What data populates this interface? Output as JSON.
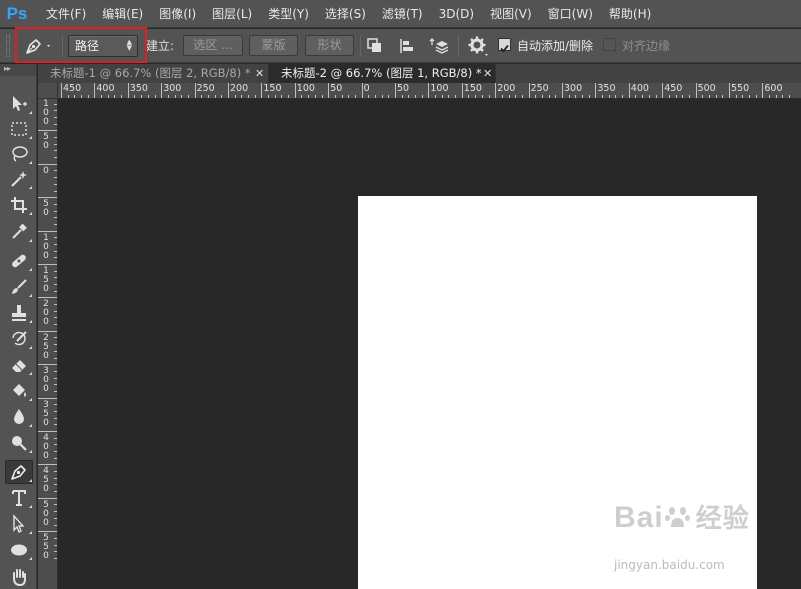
{
  "app": {
    "logo": "Ps"
  },
  "menu": [
    "文件(F)",
    "编辑(E)",
    "图像(I)",
    "图层(L)",
    "类型(Y)",
    "选择(S)",
    "滤镜(T)",
    "3D(D)",
    "视图(V)",
    "窗口(W)",
    "帮助(H)"
  ],
  "options": {
    "tool_icon": "pen-icon",
    "mode": "路径",
    "make_label": "建立:",
    "selection_btn": "选区 ...",
    "mask_btn": "蒙版",
    "shape_btn": "形状",
    "auto_add_delete_label": "自动添加/删除",
    "auto_add_delete_checked": true,
    "align_edges_label": "对齐边缘",
    "align_edges_checked": false
  },
  "toolbox": {
    "header": "▸▸",
    "tools": [
      "move-tool",
      "marquee-tool",
      "lasso-tool",
      "magic-wand-tool",
      "crop-tool",
      "eyedropper-tool",
      "healing-brush-tool",
      "brush-tool",
      "clone-stamp-tool",
      "history-brush-tool",
      "eraser-tool",
      "paint-bucket-tool",
      "blur-tool",
      "dodge-tool",
      "pen-tool",
      "type-tool",
      "path-selection-tool",
      "ellipse-tool",
      "hand-tool"
    ],
    "active": "pen-tool"
  },
  "tabs": [
    {
      "title": "未标题-1 @ 66.7% (图层 2, RGB/8) *",
      "active": false
    },
    {
      "title": "未标题-2 @ 66.7% (图层 1, RGB/8) *",
      "active": true
    }
  ],
  "ruler": {
    "h_labels": [
      "450",
      "400",
      "350",
      "300",
      "250",
      "200",
      "150",
      "100",
      "50",
      "0",
      "50",
      "100",
      "150",
      "200",
      "250",
      "300",
      "350",
      "400",
      "450",
      "500",
      "550",
      "600"
    ],
    "v_labels": [
      "100",
      "50",
      "0",
      "50",
      "100",
      "150",
      "200",
      "250",
      "300",
      "350",
      "400",
      "450",
      "500",
      "550"
    ]
  },
  "watermark": {
    "logo": "Bai",
    "logo_cn": "经验",
    "url": "jingyan.baidu.com"
  },
  "colors": {
    "accent": "#31a8ff",
    "highlight": "#e02020",
    "chrome": "#535353",
    "workspace": "#282828"
  }
}
